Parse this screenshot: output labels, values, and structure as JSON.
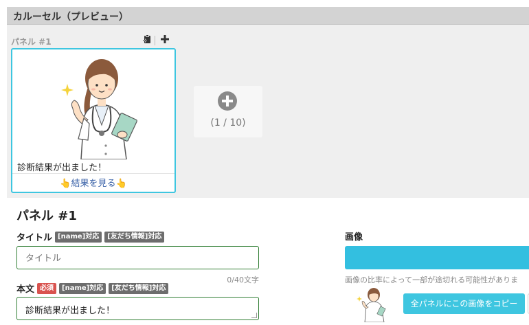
{
  "header": {
    "title": "カルーセル（プレビュー）"
  },
  "preview": {
    "panel_label": "パネル #1",
    "tools": {
      "copy_icon": "clipboard-icon",
      "add_icon": "plus-icon"
    },
    "card": {
      "text": "診断結果が出ました！",
      "action": "👆結果を見る👆"
    },
    "add_panel": {
      "icon": "plus-circle-icon",
      "count": "(1 / 10)"
    }
  },
  "editor": {
    "section_title": "パネル #1",
    "title_field": {
      "label": "タイトル",
      "badges": [
        "[name]対応",
        "[友だち情報]対応"
      ],
      "placeholder": "タイトル",
      "counter": "0/40文字"
    },
    "body_field": {
      "label": "本文",
      "required_badge": "必須",
      "badges": [
        "[name]対応",
        "[友だち情報]対応"
      ],
      "value": "診断結果が出ました！"
    },
    "image": {
      "label": "画像",
      "note": "画像の比率によって一部が途切れる可能性がありま",
      "copy_button": "全パネルにこの画像をコピー"
    }
  },
  "colors": {
    "accent": "#3ec6e0",
    "input_border": "#2f7d32",
    "required": "#d9534f"
  }
}
